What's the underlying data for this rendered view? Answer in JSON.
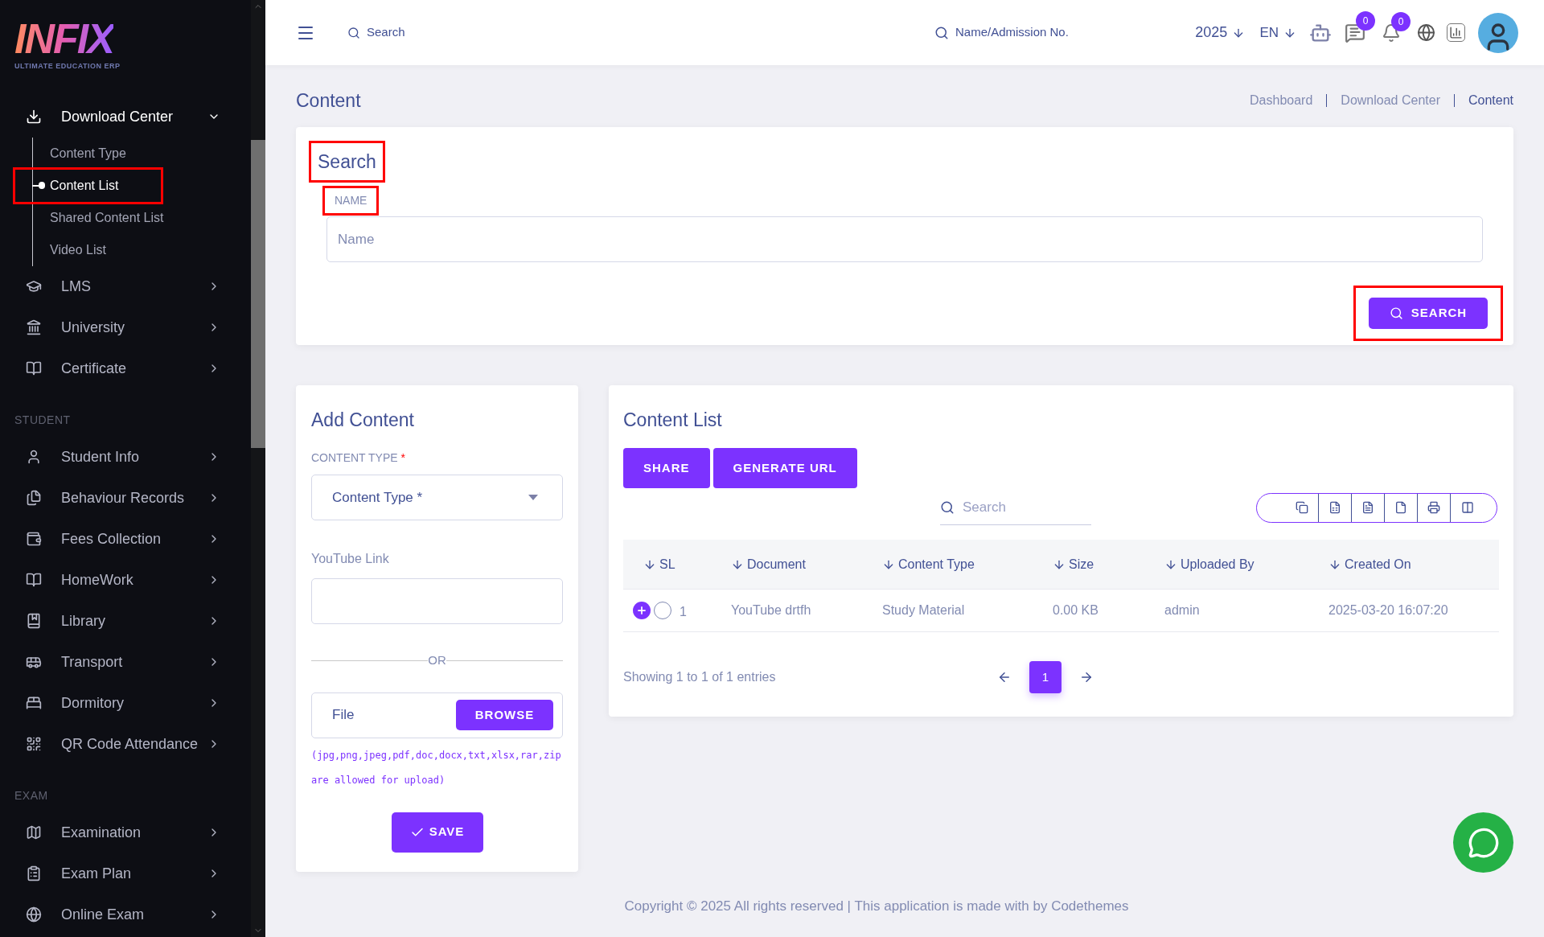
{
  "logo": {
    "name": "INFIX",
    "tagline": "ULTIMATE EDUCATION ERP"
  },
  "sidebar": {
    "groups": [
      {
        "items": [
          {
            "label": "Download Center",
            "expanded": true,
            "children": [
              {
                "label": "Content Type",
                "selected": false,
                "highlighted": false
              },
              {
                "label": "Content List",
                "selected": true,
                "highlighted": true
              },
              {
                "label": "Shared Content List",
                "selected": false,
                "highlighted": false
              },
              {
                "label": "Video List",
                "selected": false,
                "highlighted": false
              }
            ]
          },
          {
            "label": "LMS",
            "expanded": false
          },
          {
            "label": "University",
            "expanded": false
          },
          {
            "label": "Certificate",
            "expanded": false
          }
        ]
      },
      {
        "heading": "STUDENT",
        "items": [
          {
            "label": "Student Info",
            "expanded": false
          },
          {
            "label": "Behaviour Records",
            "expanded": false
          },
          {
            "label": "Fees Collection",
            "expanded": false
          },
          {
            "label": "HomeWork",
            "expanded": false
          },
          {
            "label": "Library",
            "expanded": false
          },
          {
            "label": "Transport",
            "expanded": false
          },
          {
            "label": "Dormitory",
            "expanded": false
          },
          {
            "label": "QR Code Attendance",
            "expanded": false
          }
        ]
      },
      {
        "heading": "EXAM",
        "items": [
          {
            "label": "Examination",
            "expanded": false
          },
          {
            "label": "Exam Plan",
            "expanded": false
          },
          {
            "label": "Online Exam",
            "expanded": false
          }
        ]
      }
    ]
  },
  "header": {
    "search_placeholder": "Search",
    "student_search": "Name/Admission No.",
    "year": "2025",
    "language": "EN",
    "messages_badge": "0",
    "notifications_badge": "0"
  },
  "page": {
    "title": "Content",
    "breadcrumbs": [
      {
        "label": "Dashboard",
        "selected": false
      },
      {
        "label": "Download Center",
        "selected": false
      },
      {
        "label": "Content",
        "selected": true
      }
    ]
  },
  "search_card": {
    "title": "Search",
    "title_highlighted": true,
    "name_label": "NAME",
    "label_highlighted": true,
    "name_placeholder": "Name",
    "button": "SEARCH",
    "button_highlighted": true
  },
  "add_content": {
    "title": "Add Content",
    "content_type_label": "CONTENT TYPE",
    "required": true,
    "required_mark": "*",
    "content_type_placeholder": "Content Type *",
    "youtube_label": "YouTube Link",
    "or": "OR",
    "file_placeholder": "File",
    "browse": "BROWSE",
    "hint": "(jpg,png,jpeg,pdf,doc,docx,txt,xlsx,rar,zip are allowed for upload)",
    "save": "SAVE"
  },
  "content_list": {
    "title": "Content List",
    "buttons": [
      "SHARE",
      "GENERATE URL"
    ],
    "search_placeholder": "Search",
    "columns": [
      "SL",
      "Document",
      "Content Type",
      "Size",
      "Uploaded By",
      "Created On"
    ],
    "rows": [
      {
        "checked": false,
        "cells": [
          "1",
          "YouTube drtfh",
          "Study Material",
          "0.00 KB",
          "admin",
          "2025-03-20 16:07:20"
        ]
      }
    ],
    "info": "Showing 1 to 1 of 1 entries",
    "pages": [
      {
        "label": "1",
        "selected": true
      }
    ]
  },
  "footer": "Copyright © 2025 All rights reserved | This application is made with by Codethemes"
}
